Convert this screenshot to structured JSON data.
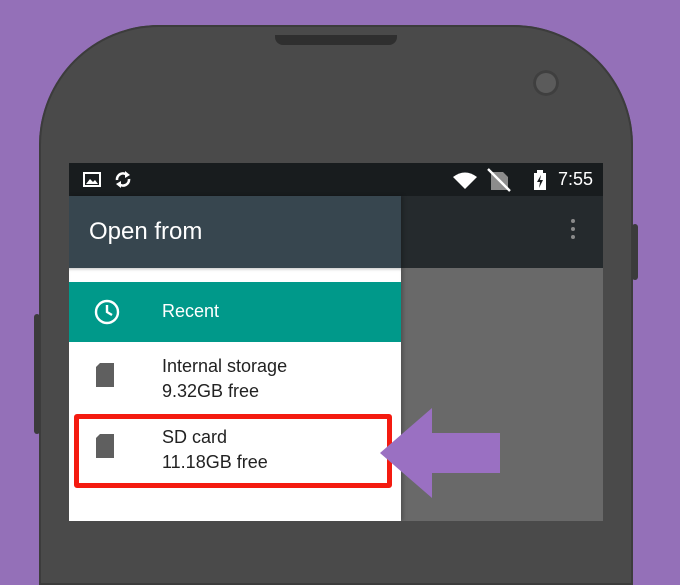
{
  "colors": {
    "background": "#9470b8",
    "drawer_header": "#37464f",
    "selected_item": "#00998a",
    "highlight": "#f41b10",
    "arrow": "#9a70c2"
  },
  "status_bar": {
    "icons": [
      "image-icon",
      "sync-icon",
      "wifi-icon",
      "no-sim-icon",
      "battery-charging-icon"
    ],
    "time": "7:55"
  },
  "drawer": {
    "title": "Open from",
    "items": [
      {
        "icon": "clock-icon",
        "label": "Recent",
        "selected": true
      },
      {
        "icon": "sd-card-icon",
        "label": "Internal storage",
        "detail": "9.32GB free"
      },
      {
        "icon": "sd-card-icon",
        "label": "SD card",
        "detail": "11.18GB free",
        "highlighted": true
      }
    ]
  }
}
